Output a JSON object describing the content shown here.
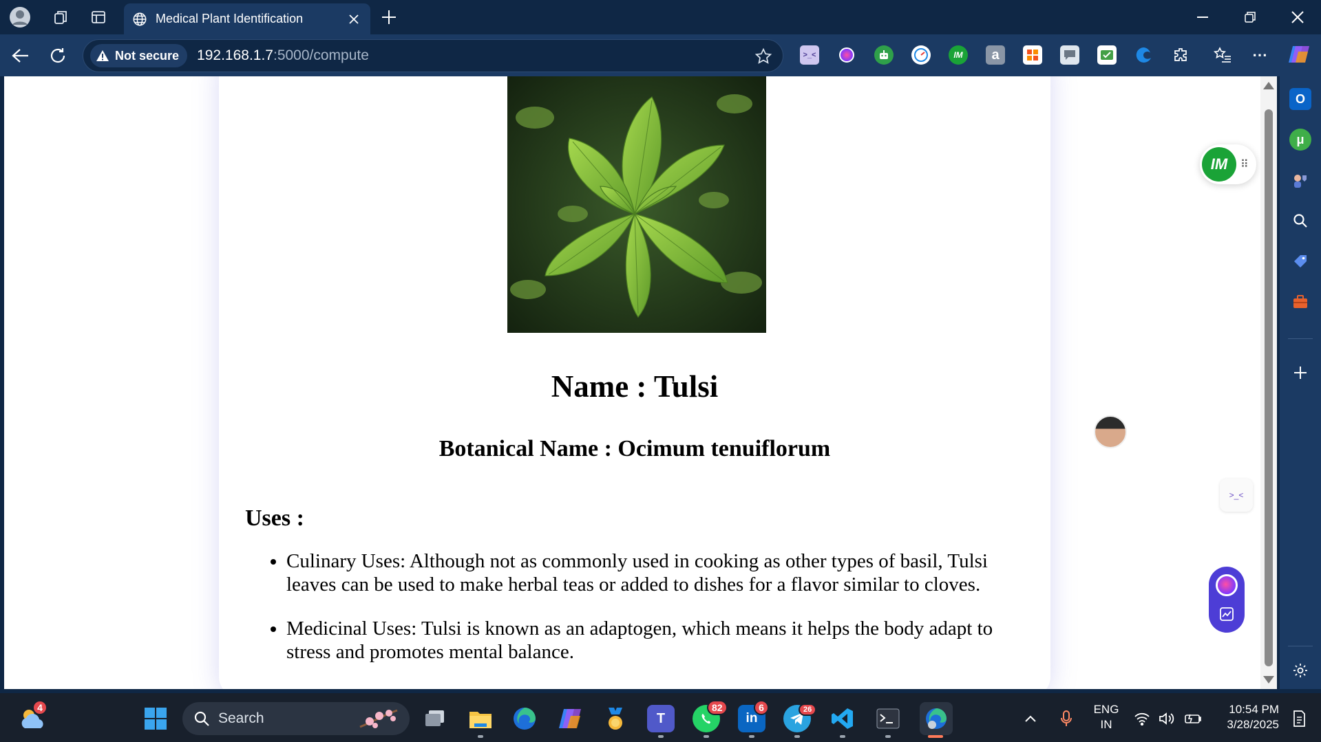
{
  "browser": {
    "tab_title": "Medical Plant Identification",
    "security_label": "Not secure",
    "url_host": "192.168.1.7",
    "url_path": ":5000/compute"
  },
  "page": {
    "plant_image_alt": "Tulsi plant",
    "name_line": "Name : Tulsi",
    "botanical_line": "Botanical Name : Ocimum tenuiflorum",
    "uses_heading": "Uses :",
    "uses": [
      "Culinary Uses: Although not as commonly used in cooking as other types of basil, Tulsi leaves can be used to make herbal teas or added to dishes for a flavor similar to cloves.",
      "Medicinal Uses: Tulsi is known as an adaptogen, which means it helps the body adapt to stress and promotes mental balance."
    ]
  },
  "widgets": {
    "im_label": "IM",
    "kaomoji": ">_<"
  },
  "extensions": {
    "im_label": "IM",
    "amazon_label": "a"
  },
  "taskbar": {
    "search_placeholder": "Search",
    "weather_badge": "4",
    "whatsapp_badge": "82",
    "linkedin_badge": "6",
    "telegram_badge": "26",
    "language_line1": "ENG",
    "language_line2": "IN",
    "time": "10:54 PM",
    "date": "3/28/2025"
  },
  "colors": {
    "browser_frame": "#0f2745",
    "toolbar": "#1b3a63",
    "taskbar": "#18202c",
    "card_shadow": "#7878dc"
  }
}
